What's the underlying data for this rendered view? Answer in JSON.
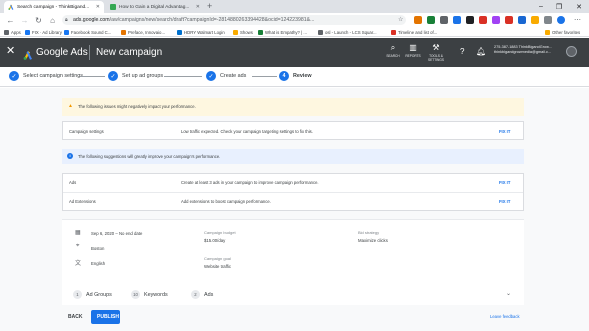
{
  "browser": {
    "tabs": [
      {
        "title": "Search campaign - ThinkBigand...",
        "active": true
      },
      {
        "title": "How to Gain a Digital Advantag...",
        "active": false
      }
    ],
    "new_tab": "+",
    "window_controls": [
      "–",
      "❐",
      "✕"
    ],
    "url_host": "ads.google.com",
    "url_path": "/aw/campaigns/new/search/draft?campaignId=-2814880263394428&ocid=124223981&...",
    "bookmarks": [
      "Apps",
      "FIX · Ad Library",
      "Facebook Sound C...",
      "Preface, Innovaio...",
      "HDRY Walmart Login",
      "Shows",
      "What is Empathy? | ...",
      "osl - Launch - LCS Squar...",
      "Timeline and list of...",
      "Other favorites"
    ],
    "colors": {
      "tab_strip": "#dee1e6",
      "omnibox": "#f1f3f4"
    }
  },
  "header": {
    "brand": "Google Ads",
    "title": "New campaign",
    "tools": [
      {
        "icon": "search-icon",
        "label": "SEARCH"
      },
      {
        "icon": "reports-icon",
        "label": "REPORTS"
      },
      {
        "icon": "tools-icon",
        "label": "TOOLS & SETTINGS"
      }
    ],
    "account_line1": "275-387-1883 ThinkBigandGrow...",
    "account_line2": "thinkbigandgrowmedia@gmail.c...",
    "colors": {
      "background": "#3c4043"
    }
  },
  "stepper": {
    "steps": [
      {
        "label": "Select campaign settings",
        "state": "done"
      },
      {
        "label": "Set up ad groups",
        "state": "done"
      },
      {
        "label": "Create ads",
        "state": "done"
      },
      {
        "label": "Review",
        "state": "current",
        "number": "4"
      }
    ],
    "accent": "#1a73e8"
  },
  "review": {
    "warning_banner": "The following issues might negatively impact your performance.",
    "warnings": [
      {
        "item": "Campaign settings",
        "message": "Low traffic expected. Check your campaign targeting settings to fix this.",
        "action": "FIX IT"
      }
    ],
    "info_banner": "The following suggestions will greatly improve your campaign's performance.",
    "suggestions": [
      {
        "item": "Ads",
        "message": "Create at least 3 ads in your campaign to improve campaign performance.",
        "action": "FIX IT"
      },
      {
        "item": "Ad Extensions",
        "message": "Add extensions to boost campaign performance.",
        "action": "FIX IT"
      }
    ]
  },
  "summary": {
    "dates": "Sep 6, 2020 – No end date",
    "location": "Boston",
    "language": "English",
    "budget_label": "Campaign budget",
    "budget_value": "$15.00/day",
    "bid_label": "Bid strategy",
    "bid_value": "Maximize clicks",
    "goal_label": "Campaign goal",
    "goal_value": "Website traffic",
    "counts": [
      {
        "count": "1",
        "label": "Ad Groups"
      },
      {
        "count": "10",
        "label": "Keywords"
      },
      {
        "count": "2",
        "label": "Ads"
      }
    ]
  },
  "footer": {
    "back": "BACK",
    "publish": "PUBLISH",
    "feedback": "Leave feedback"
  }
}
